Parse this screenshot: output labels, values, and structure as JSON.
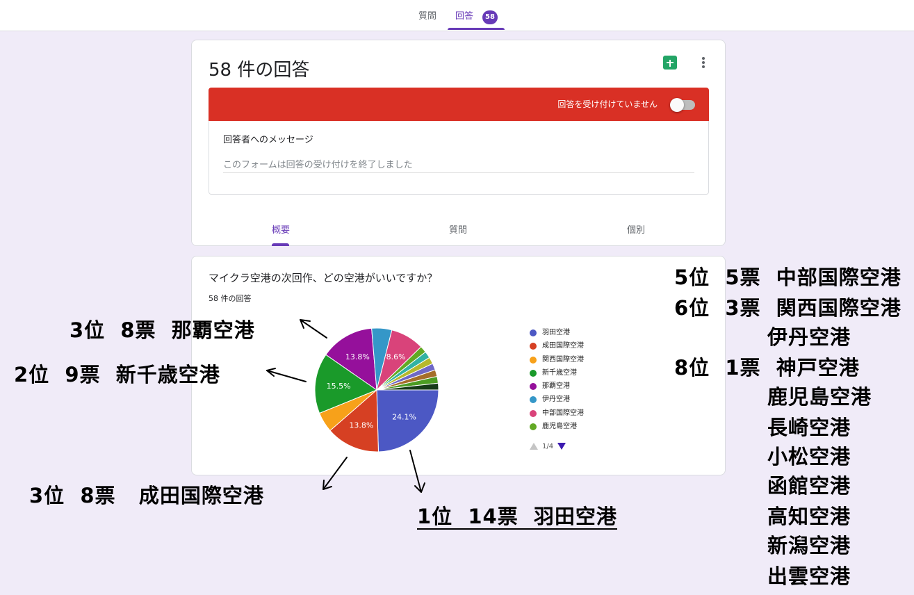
{
  "top_tabs": {
    "questions": "質問",
    "responses": "回答",
    "badge": "58"
  },
  "summary_card": {
    "title": "58 件の回答",
    "sheets_icon": "sheets-icon",
    "more_icon": "more-vert-icon",
    "banner_text": "回答を受け付けていません",
    "accepting_responses": false,
    "message_label": "回答者へのメッセージ",
    "message_value": "このフォームは回答の受け付けを終了しました",
    "tabs": [
      "概要",
      "質問",
      "個別"
    ],
    "active_tab": "概要"
  },
  "question_card": {
    "title": "マイクラ空港の次回作、どの空港がいいですか？",
    "count": "58 件の回答",
    "pager": "1/4"
  },
  "colors": {
    "accent": "#673ab7",
    "banner": "#d93025",
    "background": "#f0ebf8"
  },
  "chart_data": {
    "type": "pie",
    "total": 58,
    "slices": [
      {
        "name": "羽田空港",
        "value": 14,
        "label": "24.1%",
        "color": "#4c58c4"
      },
      {
        "name": "成田国際空港",
        "value": 8,
        "label": "13.8%",
        "color": "#d64023"
      },
      {
        "name": "関西国際空港",
        "value": 3,
        "label": "",
        "color": "#f7a11a"
      },
      {
        "name": "新千歳空港",
        "value": 9,
        "label": "15.5%",
        "color": "#1a9a2a"
      },
      {
        "name": "那覇空港",
        "value": 8,
        "label": "13.8%",
        "color": "#95109b"
      },
      {
        "name": "伊丹空港",
        "value": 3,
        "label": "",
        "color": "#3597c8"
      },
      {
        "name": "中部国際空港",
        "value": 5,
        "label": "8.6%",
        "color": "#d9437a"
      },
      {
        "name": "鹿児島空港",
        "value": 1,
        "label": "",
        "color": "#62a924"
      },
      {
        "name": "",
        "value": 1,
        "label": "",
        "color": "#32b3a3"
      },
      {
        "name": "",
        "value": 1,
        "label": "",
        "color": "#b6b92c"
      },
      {
        "name": "",
        "value": 1,
        "label": "",
        "color": "#6f68c6"
      },
      {
        "name": "",
        "value": 1,
        "label": "",
        "color": "#a56e2a"
      },
      {
        "name": "",
        "value": 1,
        "label": "",
        "color": "#4c9c23"
      },
      {
        "name": "",
        "value": 1,
        "label": "",
        "color": "#173b19"
      }
    ],
    "legend": [
      "羽田空港",
      "成田国際空港",
      "関西国際空港",
      "新千歳空港",
      "那覇空港",
      "伊丹空港",
      "中部国際空港",
      "鹿児島空港"
    ]
  },
  "annotations": {
    "naha": "3位  8票  那覇空港",
    "shinchitose": "2位  9票  新千歳空港",
    "narita": "3位  8票   成田国際空港",
    "haneda": "1位  14票  羽田空港",
    "chubu": "5位  5票  中部国際空港",
    "kansai": "6位  3票  関西国際空港",
    "itami": "伊丹空港",
    "kobe": "8位  1票  神戸空港",
    "kagoshima": "鹿児島空港",
    "nagasaki": "長崎空港",
    "komatsu": "小松空港",
    "hakodate": "函館空港",
    "kochi": "高知空港",
    "niigata": "新潟空港",
    "izumo": "出雲空港"
  }
}
